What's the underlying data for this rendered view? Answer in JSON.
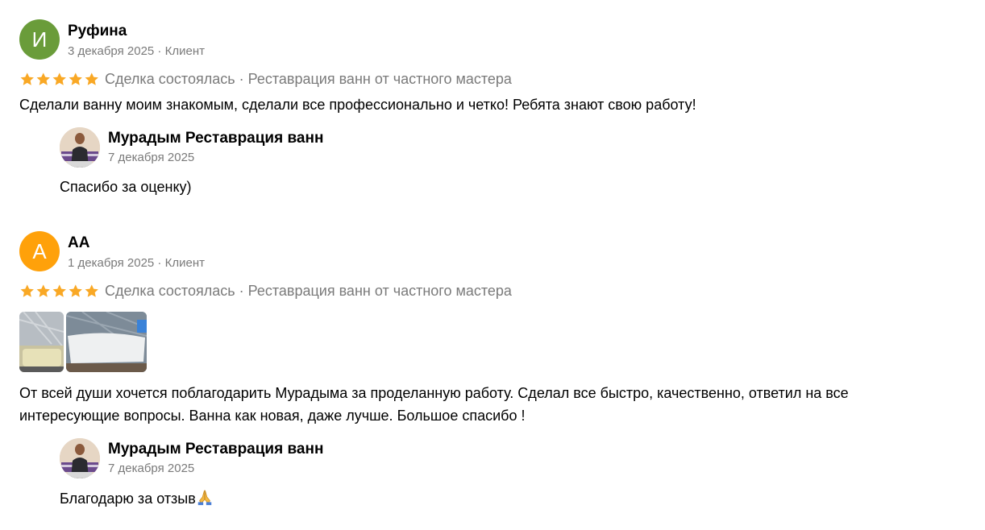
{
  "reviews": [
    {
      "initial": "И",
      "avatar_color": "#6a9c3a",
      "name": "Руфина",
      "date": "3 декабря 2025",
      "role": "Клиент",
      "rating": 5,
      "deal": "Сделка состоялась · Реставрация ванн от частного мастера",
      "text": "Сделали ванну моим знакомым, сделали все профессионально и четко! Ребята знают свою работу!",
      "reply": {
        "name": "Мурадым Реставрация ванн",
        "date": "7 декабря 2025",
        "text": "Спасибо за оценку)"
      }
    },
    {
      "initial": "А",
      "avatar_color": "#ffa10a",
      "name": "АА",
      "date": "1 декабря 2025",
      "role": "Клиент",
      "rating": 5,
      "deal": "Сделка состоялась · Реставрация ванн от частного мастера",
      "photos_count": 2,
      "text_line1": "От всей души хочется поблагодарить Мурадыма за проделанную работу. Сделал все быстро, качественно, ответил на все",
      "text_line2": "интересующие вопросы. Ванна как новая, даже лучше. Большое спасибо !",
      "reply": {
        "name": "Мурадым Реставрация ванн",
        "date": "7 декабря 2025",
        "text": "Благодарю за отзыв",
        "emoji": "folded-hands"
      }
    }
  ],
  "colors": {
    "star": "#f9a825",
    "meta_text": "#7a7a7a"
  }
}
